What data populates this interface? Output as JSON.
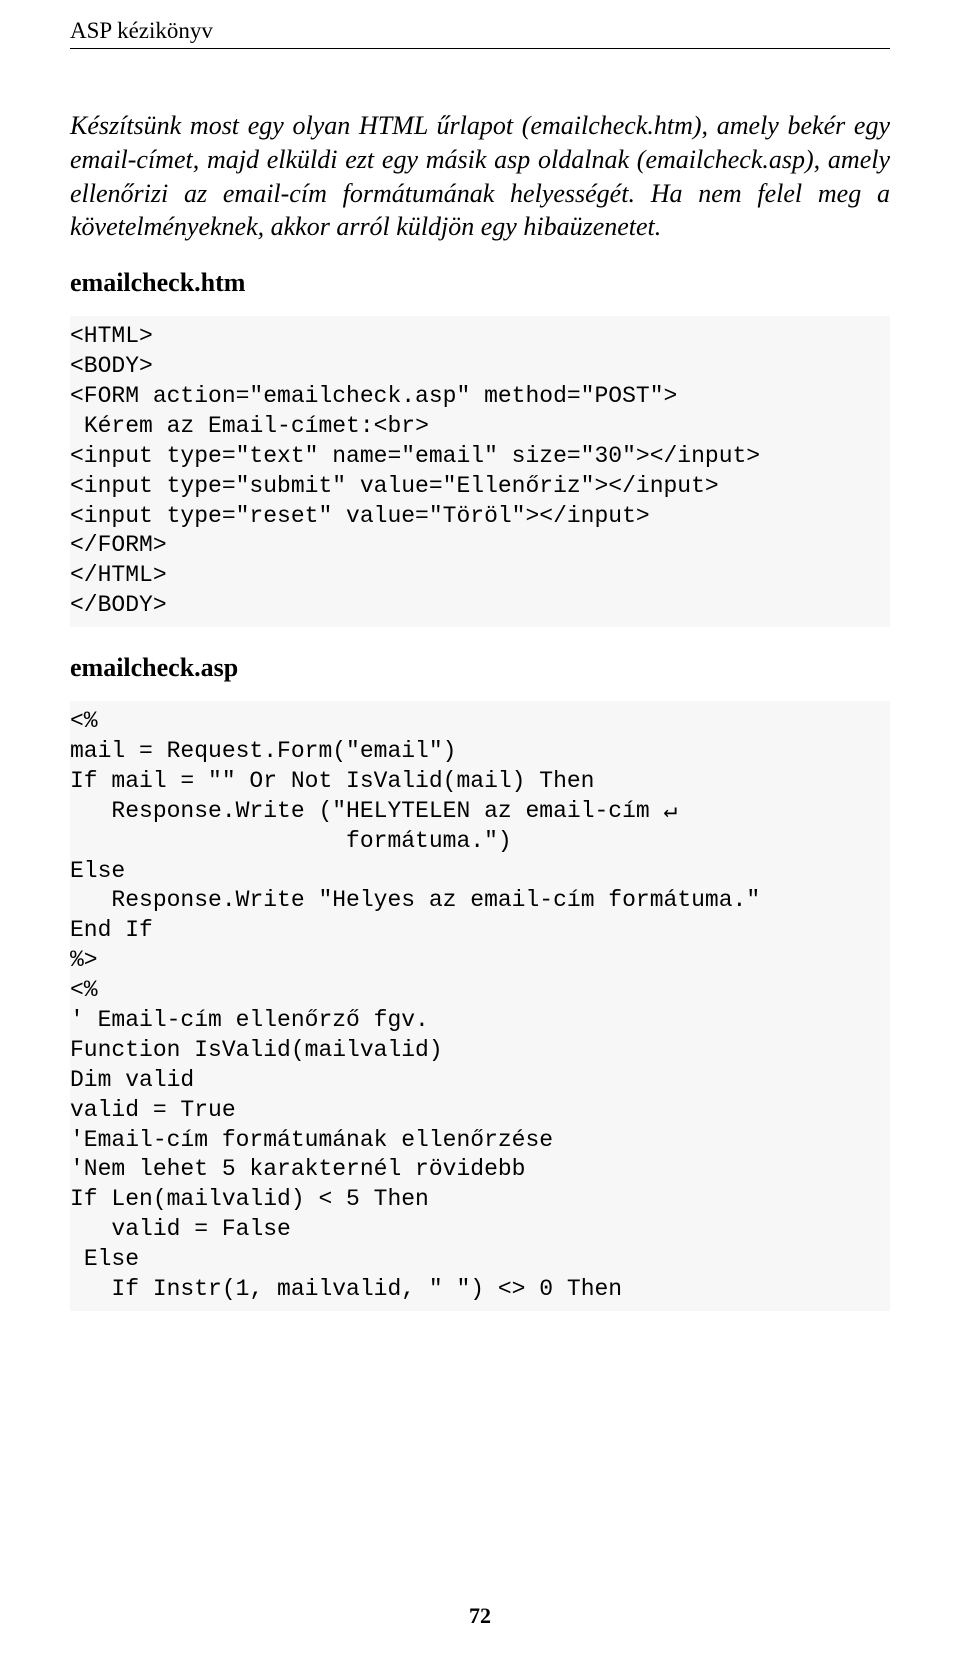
{
  "header": {
    "title": "ASP kézikönyv"
  },
  "intro": {
    "paragraph": "Készítsünk most egy olyan HTML űrlapot (emailcheck.htm), amely bekér egy email-címet, majd elküldi ezt egy másik asp oldalnak (emailcheck.asp), amely ellenőrizi az email-cím formátumának helyességét. Ha nem felel meg a követelményeknek, akkor arról küldjön egy hibaüzenetet."
  },
  "section1": {
    "heading": "emailcheck.htm",
    "code": "<HTML>\n<BODY>\n<FORM action=\"emailcheck.asp\" method=\"POST\">\n Kérem az Email-címet:<br>\n<input type=\"text\" name=\"email\" size=\"30\"></input>\n<input type=\"submit\" value=\"Ellenőriz\"></input>\n<input type=\"reset\" value=\"Töröl\"></input>\n</FORM>\n</HTML>\n</BODY>"
  },
  "section2": {
    "heading": "emailcheck.asp",
    "code": "<%\nmail = Request.Form(\"email\")\nIf mail = \"\" Or Not IsValid(mail) Then\n   Response.Write (\"HELYTELEN az email-cím ↵\n                    formátuma.\")\nElse\n   Response.Write \"Helyes az email-cím formátuma.\"\nEnd If\n%>\n<%\n' Email-cím ellenőrző fgv.\nFunction IsValid(mailvalid)\nDim valid\nvalid = True\n'Email-cím formátumának ellenőrzése\n'Nem lehet 5 karakternél rövidebb\nIf Len(mailvalid) < 5 Then\n   valid = False\n Else\n   If Instr(1, mailvalid, \" \") <> 0 Then"
  },
  "footer": {
    "page_number": "72"
  }
}
